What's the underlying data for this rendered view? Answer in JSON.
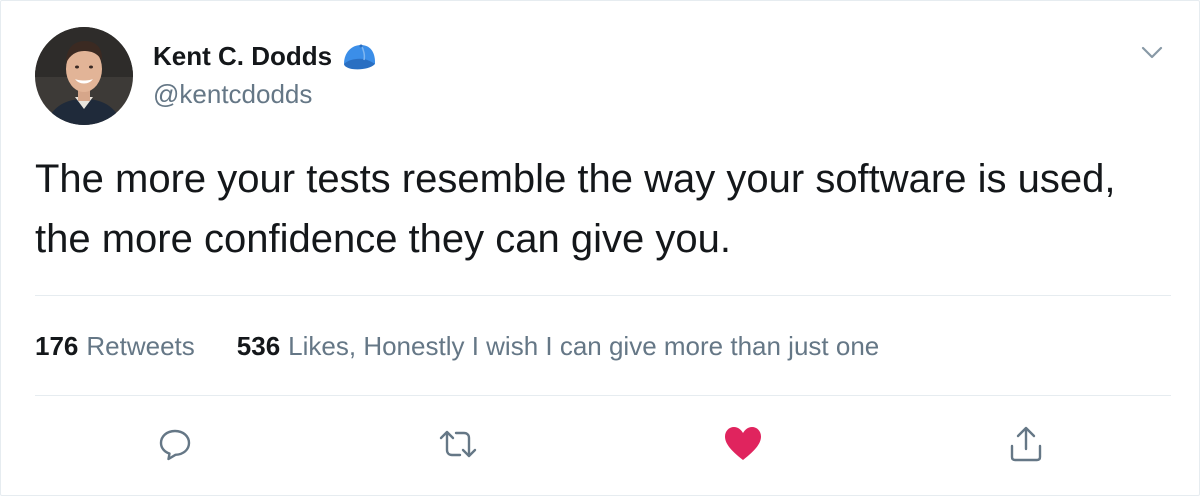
{
  "user": {
    "display_name": "Kent C. Dodds",
    "handle": "@kentcdodds",
    "name_badge_icon": "blue-cap-icon"
  },
  "tweet": {
    "text": "The more your tests resemble the way your software is used, the more confidence they can give you."
  },
  "stats": {
    "retweets_count": "176",
    "retweets_label": "Retweets",
    "likes_count": "536",
    "likes_label": "Likes, Honestly I wish I can give more than just one"
  },
  "actions": {
    "reply_icon": "comment-bubble-icon",
    "retweet_icon": "retweet-arrows-icon",
    "like_icon": "heart-icon",
    "share_icon": "share-upload-icon"
  },
  "colors": {
    "text_primary": "#14171a",
    "text_secondary": "#657786",
    "divider": "#e6ecf0",
    "like_active": "#e0245e",
    "cap_blue": "#3b8ee8"
  }
}
